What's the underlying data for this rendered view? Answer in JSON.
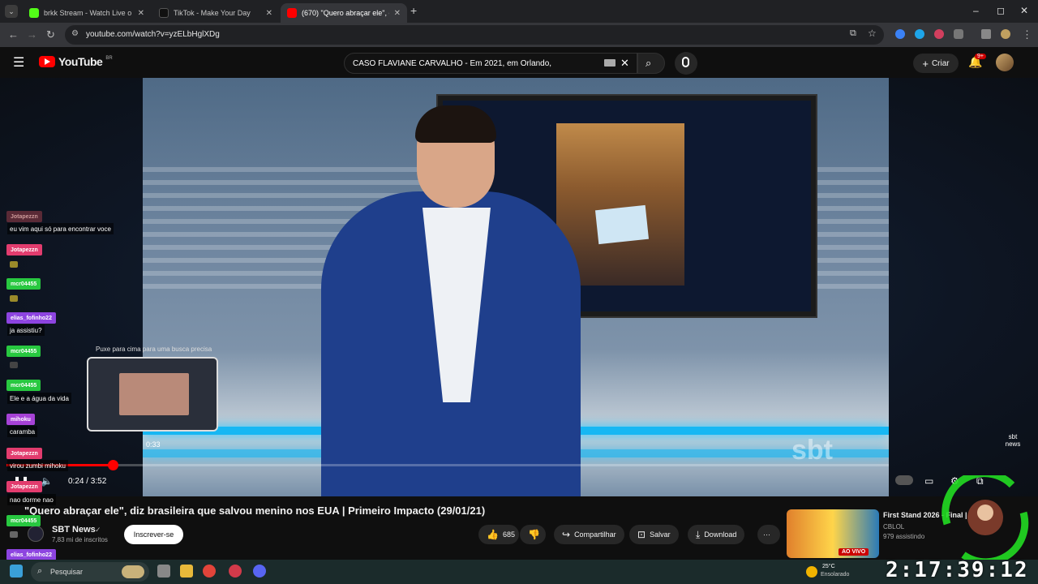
{
  "browser": {
    "tabs": [
      {
        "title": "brkk Stream - Watch Live o",
        "color": "#53fc18",
        "active": false
      },
      {
        "title": "TikTok - Make Your Day",
        "color": "#111111",
        "active": false
      },
      {
        "title": "(670) \"Quero abraçar ele\", d",
        "color": "#ff0000",
        "active": true
      }
    ],
    "new_tab": "+",
    "url": "youtube.com/watch?v=yzELbHglXDg"
  },
  "youtube": {
    "logo_text": "YouTube",
    "logo_region": "BR",
    "search_value": "CASO FLAVIANE CARVALHO - Em 2021, em Orlando,",
    "create_label": "Criar",
    "notif_count": "9+"
  },
  "player": {
    "progress_fraction": 0.12,
    "timecode": "0:24 / 3:52",
    "preview_hint": "Puxe para cima para uma busca precisa",
    "preview_time": "0:33",
    "watermark": "sbt",
    "corner_logo": "sbt news"
  },
  "video_info": {
    "title": "\"Quero abraçar ele\", diz brasileira que salvou menino nos EUA | Primeiro Impacto (29/01/21)",
    "channel": "SBT News",
    "subscribers": "7,83 mi de inscritos",
    "subscribe_label": "Inscrever-se",
    "likes": "685",
    "share_label": "Compartilhar",
    "save_label": "Salvar",
    "download_label": "Download",
    "more_label": "···"
  },
  "recommendation": {
    "title": "First Stand 2026 - Final | K",
    "channel": "CBLOL",
    "viewers": "979 assistindo",
    "live_badge": "AO VIVO"
  },
  "chat": [
    {
      "name": "Jotapezzn",
      "color": "#e23c6e",
      "message": "eu vim aqui só para encontrar voce"
    },
    {
      "name": "Jotapezzn",
      "color": "#e23c6e",
      "message": ""
    },
    {
      "name": "mcr04455",
      "color": "#28c840",
      "message": ""
    },
    {
      "name": "elias_fofinho22",
      "color": "#8d44e0",
      "message": "ja assistiu?"
    },
    {
      "name": "mcr04455",
      "color": "#28c840",
      "message": ""
    },
    {
      "name": "mcr04455",
      "color": "#28c840",
      "message": "Ele e a água da vida"
    },
    {
      "name": "mihoku",
      "color": "#a642d6",
      "message": "caramba"
    },
    {
      "name": "Jotapezzn",
      "color": "#e23c6e",
      "message": "virou zumbi mihoku"
    },
    {
      "name": "Jotapezzn",
      "color": "#e23c6e",
      "message": "nao dorme nao"
    },
    {
      "name": "mcr04455",
      "color": "#28c840",
      "message": ""
    },
    {
      "name": "elias_fofinho22",
      "color": "#8d44e0",
      "message": ""
    }
  ],
  "overlay": {
    "brand_text": "tv gordinho",
    "clock": "2:17:39:12"
  },
  "taskbar": {
    "search_placeholder": "Pesquisar",
    "weather_temp": "25°C",
    "weather_desc": "Ensolarado"
  }
}
